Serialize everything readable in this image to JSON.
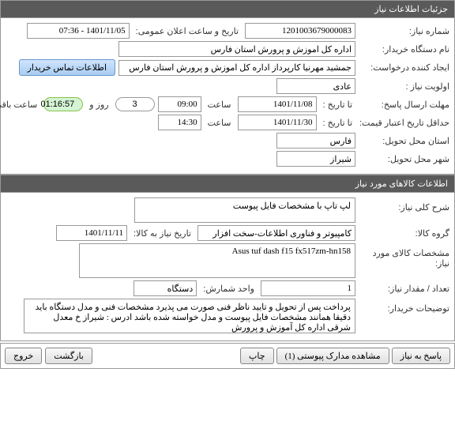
{
  "section1": {
    "title": "جزئیات اطلاعات نیاز",
    "need_no_label": "شماره نیاز:",
    "need_no": "1201003679000083",
    "announce_label": "تاریخ و ساعت اعلان عمومی:",
    "announce_value": "1401/11/05 - 07:36",
    "buyer_label": "نام دستگاه خریدار:",
    "buyer_value": "اداره کل اموزش و پرورش استان فارس",
    "creator_label": "ایجاد کننده درخواست:",
    "creator_value": "جمشید مهرنیا کارپرداز اداره کل اموزش و پرورش استان فارس",
    "contact_btn": "اطلاعات تماس خریدار",
    "priority_label": "اولویت نیاز :",
    "priority_value": "عادی",
    "deadline_reply_label": "مهلت ارسال پاسخ:",
    "to_date_label": "تا تاریخ :",
    "deadline_date": "1401/11/08",
    "time_label": "ساعت",
    "deadline_time": "09:00",
    "days_value": "3",
    "days_label": "روز و",
    "countdown": "01:16:57",
    "remaining_label": "ساعت باقی مانده",
    "min_validity_label": "حداقل تاریخ اعتبار قیمت:",
    "validity_date": "1401/11/30",
    "validity_time": "14:30",
    "delivery_state_label": "استان محل تحویل:",
    "delivery_state": "فارس",
    "delivery_city_label": "شهر محل تحویل:",
    "delivery_city": "شیراز"
  },
  "section2": {
    "title": "اطلاعات کالاهای مورد نیاز",
    "overall_label": "شرح کلی نیاز:",
    "overall_value": "لپ تاپ با مشخصات فایل پیوست",
    "group_label": "گروه کالا:",
    "group_value": "کامپیوتر و فناوری اطلاعات-سخت افزار",
    "need_date_label": "تاریخ نیاز به کالا:",
    "need_date_value": "1401/11/11",
    "spec_label": "مشخصات کالای مورد نیاز:",
    "spec_value": "Asus tuf dash f15 fx517zm-hn158",
    "qty_label": "تعداد / مقدار نیاز:",
    "qty_value": "1",
    "unit_label": "واحد شمارش:",
    "unit_value": "دستگاه",
    "buyer_notes_label": "توضیحات خریدار:",
    "buyer_notes_value": "پرداخت پس از تحویل و تایید ناظر فنی صورت می پذیرد مشخصات فنی و مدل دستگاه باید دقیقا همانند مشخصات فایل پیوست و مدل خواسته شده باشد ادرس : شیراز خ معدل شرقی اداره کل آموزش و پرورش"
  },
  "footer": {
    "reply_btn": "پاسخ به نیاز",
    "view_attach_btn": "مشاهده مدارک پیوستی (1)",
    "print_btn": "چاپ",
    "back_btn": "بازگشت",
    "exit_btn": "خروج"
  }
}
